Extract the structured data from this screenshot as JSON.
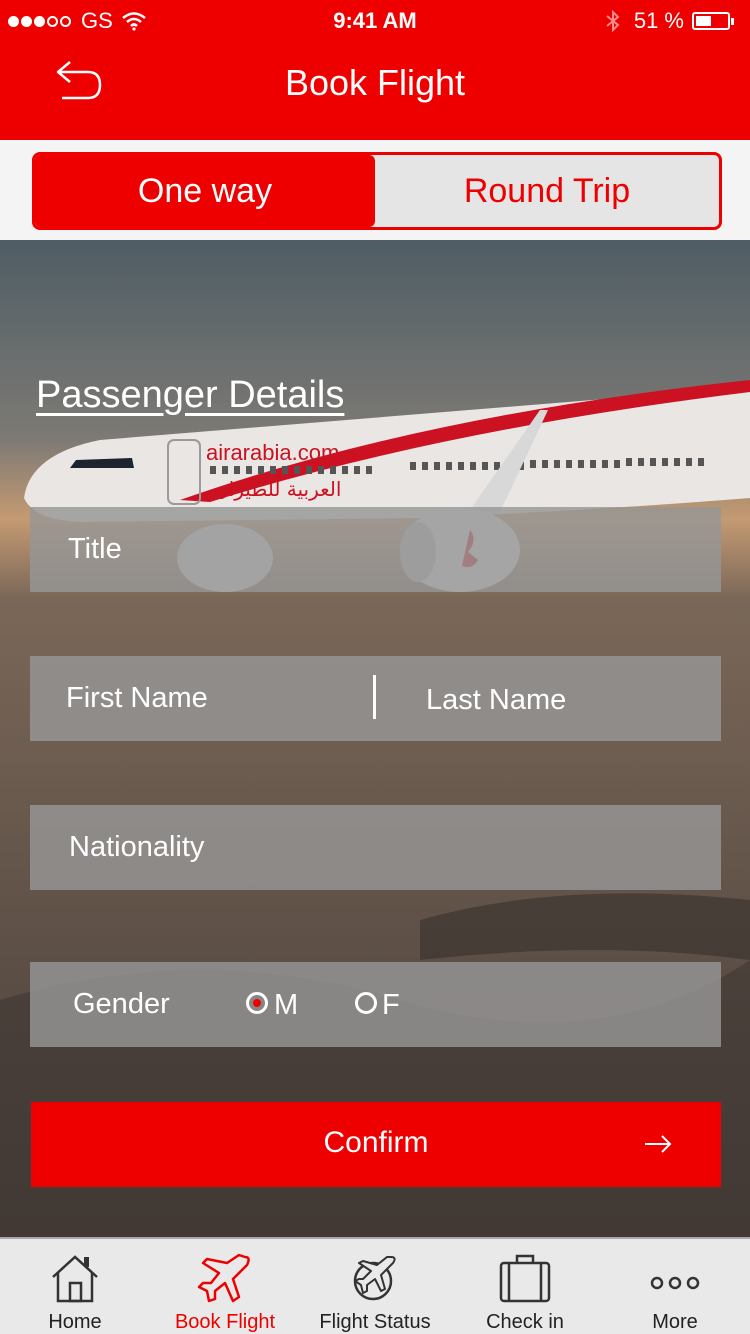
{
  "colors": {
    "brand_red": "#ee0000",
    "white": "#ffffff"
  },
  "status_bar": {
    "carrier": "GS",
    "time": "9:41 AM",
    "battery": "51 %",
    "battery_level": 0.51,
    "icons": [
      "signal-dots-icon",
      "wifi-icon",
      "bluetooth-icon",
      "battery-icon"
    ]
  },
  "nav": {
    "title": "Book Flight",
    "back_icon": "back-arrow-icon"
  },
  "trip_type": {
    "one_way": "One way",
    "round_trip": "Round Trip",
    "selected": "One way"
  },
  "form": {
    "section_title": "Passenger Details",
    "title_placeholder": "Title",
    "first_name_placeholder": "First Name",
    "last_name_placeholder": "Last Name",
    "nationality_placeholder": "Nationality",
    "gender_label": "Gender",
    "gender_male": "M",
    "gender_female": "F",
    "gender_selected": "M",
    "confirm_label": "Confirm",
    "confirm_icon": "arrow-right-icon"
  },
  "hero": {
    "airline_text": "airarabia.com",
    "airline_arabic": "العربية للطيران"
  },
  "tabs": [
    {
      "label": "Home",
      "icon": "home-icon",
      "active": false
    },
    {
      "label": "Book Flight",
      "icon": "airplane-icon",
      "active": true
    },
    {
      "label": "Flight Status",
      "icon": "flight-status-icon",
      "active": false
    },
    {
      "label": "Check in",
      "icon": "luggage-icon",
      "active": false
    },
    {
      "label": "More",
      "icon": "more-icon",
      "active": false
    }
  ]
}
